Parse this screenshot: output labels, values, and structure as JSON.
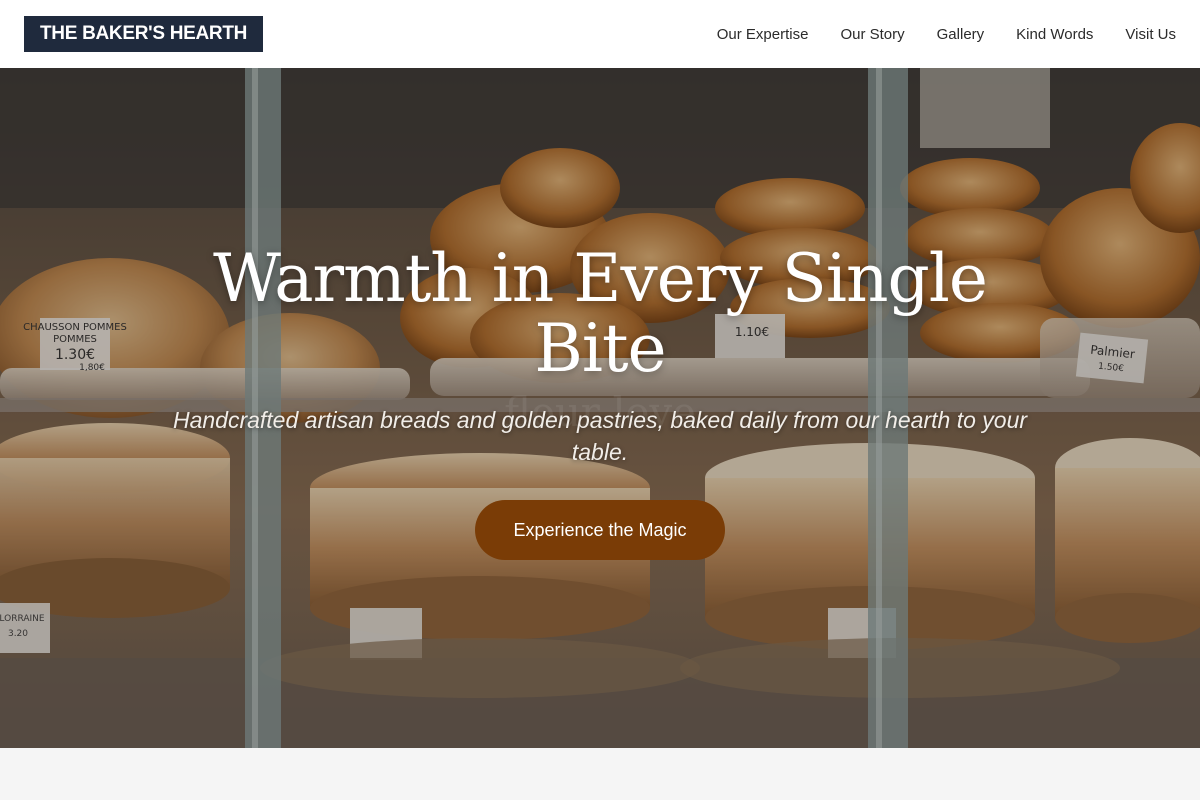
{
  "header": {
    "logo": "THE BAKER'S HEARTH",
    "nav": [
      {
        "label": "Our Expertise"
      },
      {
        "label": "Our Story"
      },
      {
        "label": "Gallery"
      },
      {
        "label": "Kind Words"
      },
      {
        "label": "Visit Us"
      }
    ]
  },
  "hero": {
    "title": "Warmth in Every Single Bite",
    "subtitle": "Handcrafted artisan breads and golden pastries, baked daily from our hearth to your table.",
    "cta_label": "Experience the Magic",
    "price_tags": {
      "tag1": "CHAUSSON POMMES",
      "tag1_price": "1.30€",
      "tag1_alt": "1,80€",
      "tag2": "1.10€",
      "tag3": "Palmier",
      "tag3_price": "1.50€",
      "tag4": "LORRAINE",
      "tag4_price": "3.20"
    },
    "watermark": "flour love"
  },
  "colors": {
    "logo_bg": "#1f2a3d",
    "cta_bg": "#7a3c06",
    "page_bg": "#f5f5f5"
  }
}
